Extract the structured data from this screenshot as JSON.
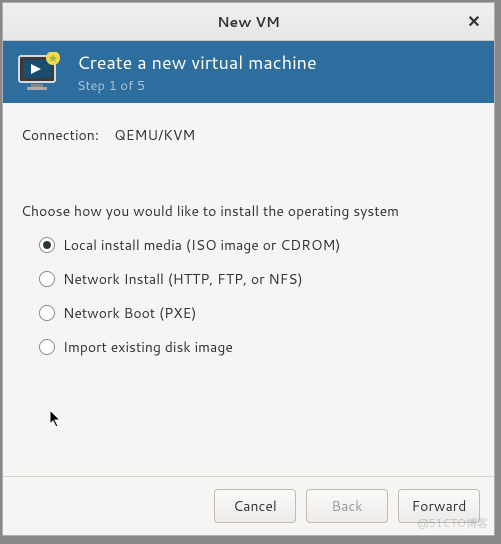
{
  "window": {
    "title": "New VM",
    "close_glyph": "✕"
  },
  "banner": {
    "title": "Create a new virtual machine",
    "step": "Step 1 of 5"
  },
  "connection": {
    "label": "Connection:",
    "value": "QEMU/KVM"
  },
  "prompt": "Choose how you would like to install the operating system",
  "options": [
    {
      "label": "Local install media (ISO image or CDROM)",
      "selected": true
    },
    {
      "label": "Network Install (HTTP, FTP, or NFS)",
      "selected": false
    },
    {
      "label": "Network Boot (PXE)",
      "selected": false
    },
    {
      "label": "Import existing disk image",
      "selected": false
    }
  ],
  "buttons": {
    "cancel": "Cancel",
    "back": "Back",
    "forward": "Forward"
  },
  "watermark": "@51CTO博客"
}
